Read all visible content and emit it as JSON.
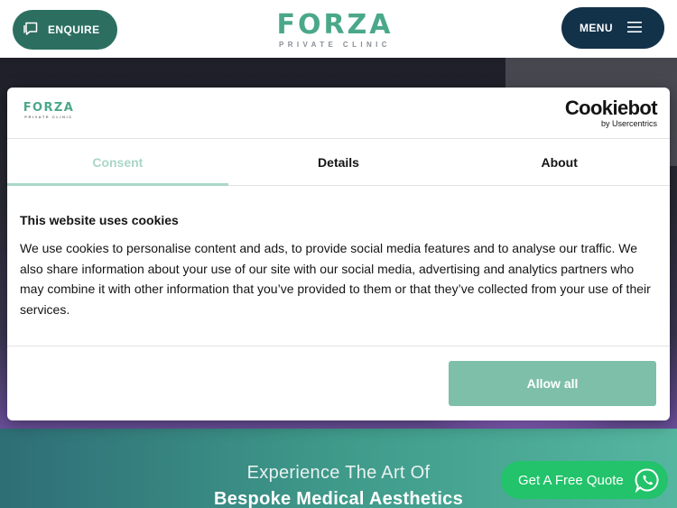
{
  "header": {
    "enquire_label": "ENQUIRE",
    "logo_main": "FORZA",
    "logo_sub": "PRIVATE CLINIC",
    "menu_label": "MENU"
  },
  "cookie_banner": {
    "logo_main": "FORZA",
    "logo_sub": "PRIVATE CLINIC",
    "provider_name": "Cookiebot",
    "provider_sub": "by Usercentrics",
    "tabs": [
      {
        "label": "Consent",
        "active": true
      },
      {
        "label": "Details",
        "active": false
      },
      {
        "label": "About",
        "active": false
      }
    ],
    "heading": "This website uses cookies",
    "body": "We use cookies to personalise content and ads, to provide social media features and to analyse our traffic. We also share information about your use of our site with our social media, advertising and analytics partners who may combine it with other information that you’ve provided to them or that they’ve collected from your use of their services.",
    "allow_all_label": "Allow all"
  },
  "hero": {
    "tagline_line1": "Experience The Art Of",
    "tagline_line2": "Bespoke Medical Aesthetics"
  },
  "quote_button": {
    "label": "Get A Free Quote",
    "icon": "whatsapp-icon"
  },
  "colors": {
    "brand_green": "#4aa88a",
    "enquire_bg": "#2c6f61",
    "menu_bg": "#12324a",
    "allow_bg": "#7ebfa9",
    "whatsapp_green": "#22c36a"
  }
}
